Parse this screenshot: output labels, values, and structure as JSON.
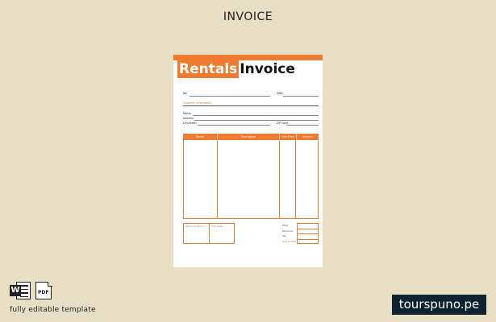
{
  "heading": "INVOICE",
  "invoice": {
    "title_part1": "Rentals",
    "title_part2": "Invoice",
    "no_label": "No:",
    "date_label": "Date:",
    "customer_section": "Customer Information",
    "name_label": "Name:",
    "address_label": "Address:",
    "city_state_label": "City/State:",
    "zip_label": "ZIP Code:",
    "table_headers": [
      "Rental",
      "Description",
      "Unit Price",
      "Amount"
    ],
    "terms_label": "Payment Terms",
    "due_label": "Due Date",
    "totals_labels": [
      "Total",
      "Discount",
      "Tax",
      "Grand Total"
    ]
  },
  "caption": "fully editable template",
  "brand": "tourspuno.pe",
  "icons": [
    "word-icon",
    "pdf-icon"
  ],
  "colors": {
    "accent": "#f07a2e",
    "background": "#e6dfc3",
    "brand_bg": "#0d2330"
  }
}
